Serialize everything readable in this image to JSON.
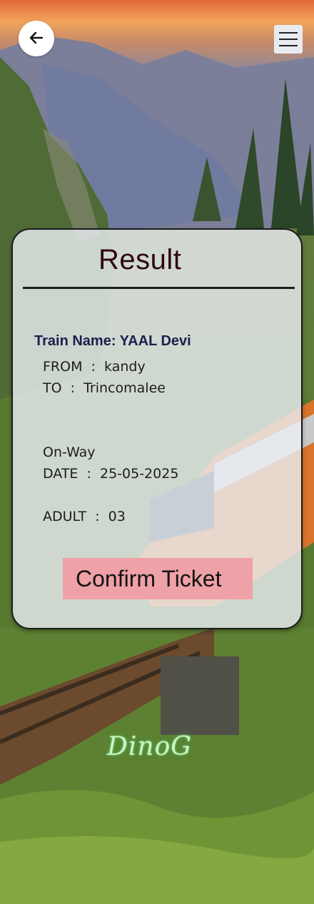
{
  "header": {
    "back_icon": "arrow-left-icon",
    "menu_icon": "hamburger-menu-icon"
  },
  "card": {
    "title": "Result",
    "train_name": "Train Name: YAAL Devi",
    "from_line": "FROM  :  kandy",
    "to_line": "TO  :  Trincomalee",
    "trip_type": "On-Way",
    "date_line": "DATE  :  25-05-2025",
    "adult_line": "ADULT  :  03",
    "confirm_label": "Confirm Ticket"
  },
  "signature": "DinoG",
  "colors": {
    "title": "#2e0712",
    "train_name": "#1d1f4d",
    "confirm_bg": "#eea1a6",
    "card_bg": "#ecf0f6"
  }
}
